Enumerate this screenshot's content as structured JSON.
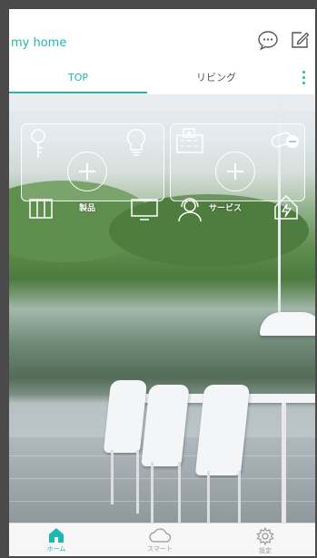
{
  "header": {
    "title": "my home",
    "chat_icon": "chat-bubble-icon",
    "edit_icon": "edit-icon"
  },
  "tabs": [
    {
      "label": "TOP",
      "active": true
    },
    {
      "label": "リビング",
      "active": false
    }
  ],
  "cards": {
    "products": {
      "label": "製品",
      "icons": [
        "key-icon",
        "lightbulb-icon",
        "window-icon",
        "tv-icon"
      ]
    },
    "services": {
      "label": "サービス",
      "icons": [
        "hospital-icon",
        "pill-icon",
        "support-agent-icon",
        "house-energy-icon"
      ]
    }
  },
  "bottom_nav": [
    {
      "label": "ホーム",
      "icon": "home-icon",
      "active": true
    },
    {
      "label": "スマート",
      "icon": "cloud-icon",
      "active": false
    },
    {
      "label": "設定",
      "icon": "gear-icon",
      "active": false
    }
  ],
  "colors": {
    "accent": "#1fb8b0",
    "inactive": "#999999"
  }
}
